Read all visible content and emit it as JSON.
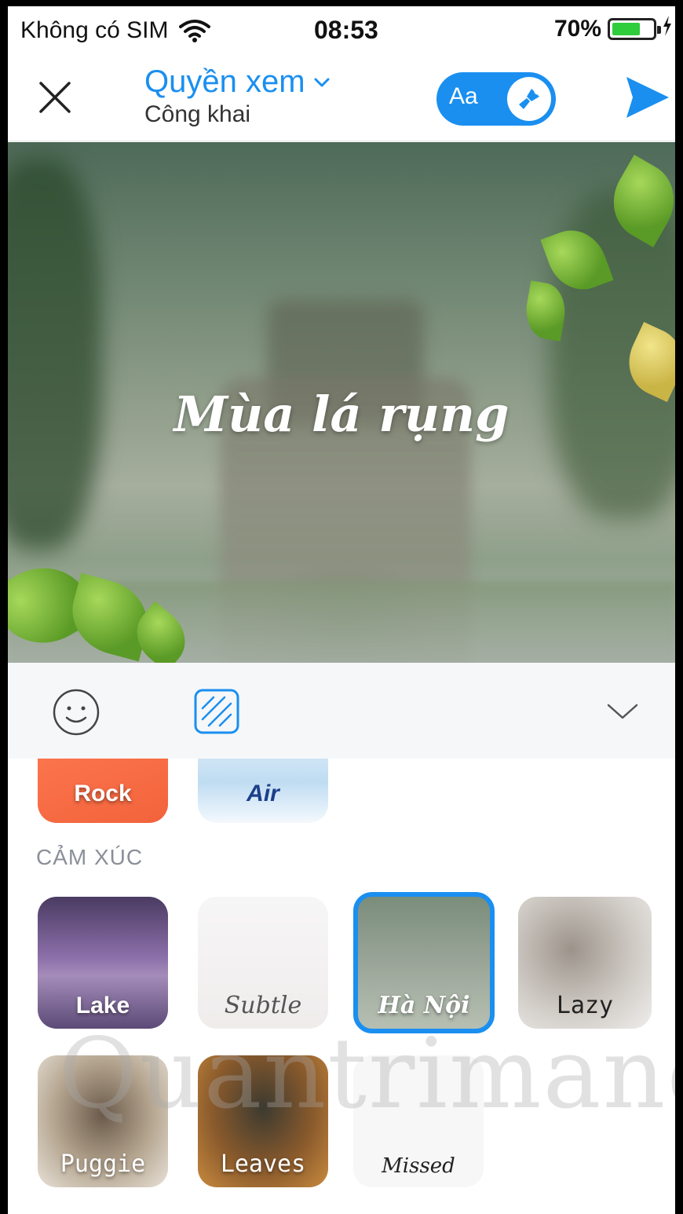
{
  "status_bar": {
    "carrier": "Không có SIM",
    "time": "08:53",
    "battery_percent": "70%",
    "battery_level": 0.7,
    "icons": [
      "wifi-icon",
      "battery-icon",
      "charging-icon"
    ]
  },
  "header": {
    "title": "Quyền xem",
    "subtitle": "Công khai",
    "toggle_label": "Aa",
    "icons": [
      "close-icon",
      "chevron-down-icon",
      "paint-brush-icon",
      "send-icon"
    ]
  },
  "canvas": {
    "text": "Mùa lá rụng"
  },
  "toolbar": {
    "icons": [
      "emoji-icon",
      "background-icon",
      "chevron-down-icon"
    ]
  },
  "panel": {
    "section_label": "CẢM XÚC",
    "top_tiles": [
      {
        "label": "Rock"
      },
      {
        "label": "Air"
      }
    ],
    "tiles": [
      {
        "label": "Lake"
      },
      {
        "label": "Subtle"
      },
      {
        "label": "Hà Nội",
        "selected": true
      },
      {
        "label": "Lazy"
      },
      {
        "label": "Puggie"
      },
      {
        "label": "Leaves"
      },
      {
        "label": "Missed"
      }
    ],
    "watermark": "Quantrimang"
  },
  "colors": {
    "accent": "#1a8ff0",
    "battery_green": "#2fcc3c"
  }
}
